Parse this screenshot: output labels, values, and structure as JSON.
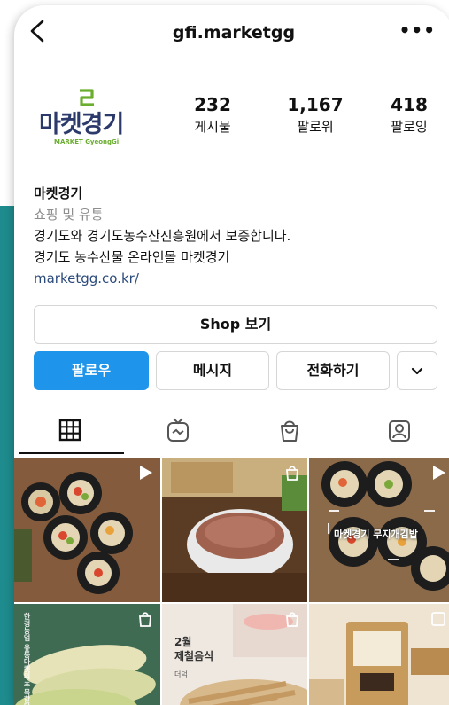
{
  "profile": {
    "username": "gfi.marketgg",
    "logo_text": "마켓경기",
    "logo_sub": "MARKET GyeongGi",
    "name": "마켓경기",
    "category": "쇼핑 및 유통",
    "bio_line1": "경기도와 경기도농수산진흥원에서 보증합니다.",
    "bio_line2": "경기도 농수산물 온라인몰 마켓경기",
    "website": "marketgg.co.kr/"
  },
  "stats": [
    {
      "value": "232",
      "label": "게시물"
    },
    {
      "value": "1,167",
      "label": "팔로워"
    },
    {
      "value": "418",
      "label": "팔로잉"
    }
  ],
  "buttons": {
    "shop": "Shop 보기",
    "follow": "팔로우",
    "message": "메시지",
    "call": "전화하기"
  },
  "tabs": [
    "grid-icon",
    "igtv-icon",
    "shop-bag-icon",
    "tagged-icon"
  ],
  "posts": [
    {
      "type": "video"
    },
    {
      "type": "shop"
    },
    {
      "type": "video",
      "overlay": "마켓경기 무지개김밥"
    },
    {
      "type": "shop",
      "overlay": "한경농업 유통마켓의 주목할만한"
    },
    {
      "type": "shop",
      "overlay_title": "2월",
      "overlay_sub": "제철음식",
      "overlay_small": "더덕"
    },
    {
      "type": "shop"
    }
  ],
  "colors": {
    "accent": "#1e94ea",
    "logo_blue": "#2c3a6b",
    "logo_green": "#6aad2f",
    "background": "#2aa3a3"
  }
}
